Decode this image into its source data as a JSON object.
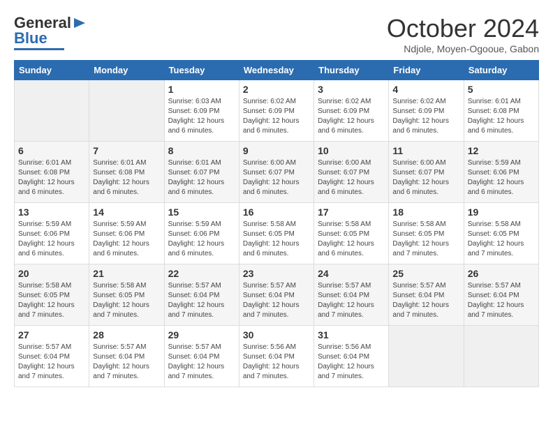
{
  "header": {
    "logo_general": "General",
    "logo_blue": "Blue",
    "month": "October 2024",
    "location": "Ndjole, Moyen-Ogooue, Gabon"
  },
  "weekdays": [
    "Sunday",
    "Monday",
    "Tuesday",
    "Wednesday",
    "Thursday",
    "Friday",
    "Saturday"
  ],
  "weeks": [
    [
      {
        "day": "",
        "content": ""
      },
      {
        "day": "",
        "content": ""
      },
      {
        "day": "1",
        "content": "Sunrise: 6:03 AM\nSunset: 6:09 PM\nDaylight: 12 hours\nand 6 minutes."
      },
      {
        "day": "2",
        "content": "Sunrise: 6:02 AM\nSunset: 6:09 PM\nDaylight: 12 hours\nand 6 minutes."
      },
      {
        "day": "3",
        "content": "Sunrise: 6:02 AM\nSunset: 6:09 PM\nDaylight: 12 hours\nand 6 minutes."
      },
      {
        "day": "4",
        "content": "Sunrise: 6:02 AM\nSunset: 6:09 PM\nDaylight: 12 hours\nand 6 minutes."
      },
      {
        "day": "5",
        "content": "Sunrise: 6:01 AM\nSunset: 6:08 PM\nDaylight: 12 hours\nand 6 minutes."
      }
    ],
    [
      {
        "day": "6",
        "content": "Sunrise: 6:01 AM\nSunset: 6:08 PM\nDaylight: 12 hours\nand 6 minutes."
      },
      {
        "day": "7",
        "content": "Sunrise: 6:01 AM\nSunset: 6:08 PM\nDaylight: 12 hours\nand 6 minutes."
      },
      {
        "day": "8",
        "content": "Sunrise: 6:01 AM\nSunset: 6:07 PM\nDaylight: 12 hours\nand 6 minutes."
      },
      {
        "day": "9",
        "content": "Sunrise: 6:00 AM\nSunset: 6:07 PM\nDaylight: 12 hours\nand 6 minutes."
      },
      {
        "day": "10",
        "content": "Sunrise: 6:00 AM\nSunset: 6:07 PM\nDaylight: 12 hours\nand 6 minutes."
      },
      {
        "day": "11",
        "content": "Sunrise: 6:00 AM\nSunset: 6:07 PM\nDaylight: 12 hours\nand 6 minutes."
      },
      {
        "day": "12",
        "content": "Sunrise: 5:59 AM\nSunset: 6:06 PM\nDaylight: 12 hours\nand 6 minutes."
      }
    ],
    [
      {
        "day": "13",
        "content": "Sunrise: 5:59 AM\nSunset: 6:06 PM\nDaylight: 12 hours\nand 6 minutes."
      },
      {
        "day": "14",
        "content": "Sunrise: 5:59 AM\nSunset: 6:06 PM\nDaylight: 12 hours\nand 6 minutes."
      },
      {
        "day": "15",
        "content": "Sunrise: 5:59 AM\nSunset: 6:06 PM\nDaylight: 12 hours\nand 6 minutes."
      },
      {
        "day": "16",
        "content": "Sunrise: 5:58 AM\nSunset: 6:05 PM\nDaylight: 12 hours\nand 6 minutes."
      },
      {
        "day": "17",
        "content": "Sunrise: 5:58 AM\nSunset: 6:05 PM\nDaylight: 12 hours\nand 6 minutes."
      },
      {
        "day": "18",
        "content": "Sunrise: 5:58 AM\nSunset: 6:05 PM\nDaylight: 12 hours\nand 7 minutes."
      },
      {
        "day": "19",
        "content": "Sunrise: 5:58 AM\nSunset: 6:05 PM\nDaylight: 12 hours\nand 7 minutes."
      }
    ],
    [
      {
        "day": "20",
        "content": "Sunrise: 5:58 AM\nSunset: 6:05 PM\nDaylight: 12 hours\nand 7 minutes."
      },
      {
        "day": "21",
        "content": "Sunrise: 5:58 AM\nSunset: 6:05 PM\nDaylight: 12 hours\nand 7 minutes."
      },
      {
        "day": "22",
        "content": "Sunrise: 5:57 AM\nSunset: 6:04 PM\nDaylight: 12 hours\nand 7 minutes."
      },
      {
        "day": "23",
        "content": "Sunrise: 5:57 AM\nSunset: 6:04 PM\nDaylight: 12 hours\nand 7 minutes."
      },
      {
        "day": "24",
        "content": "Sunrise: 5:57 AM\nSunset: 6:04 PM\nDaylight: 12 hours\nand 7 minutes."
      },
      {
        "day": "25",
        "content": "Sunrise: 5:57 AM\nSunset: 6:04 PM\nDaylight: 12 hours\nand 7 minutes."
      },
      {
        "day": "26",
        "content": "Sunrise: 5:57 AM\nSunset: 6:04 PM\nDaylight: 12 hours\nand 7 minutes."
      }
    ],
    [
      {
        "day": "27",
        "content": "Sunrise: 5:57 AM\nSunset: 6:04 PM\nDaylight: 12 hours\nand 7 minutes."
      },
      {
        "day": "28",
        "content": "Sunrise: 5:57 AM\nSunset: 6:04 PM\nDaylight: 12 hours\nand 7 minutes."
      },
      {
        "day": "29",
        "content": "Sunrise: 5:57 AM\nSunset: 6:04 PM\nDaylight: 12 hours\nand 7 minutes."
      },
      {
        "day": "30",
        "content": "Sunrise: 5:56 AM\nSunset: 6:04 PM\nDaylight: 12 hours\nand 7 minutes."
      },
      {
        "day": "31",
        "content": "Sunrise: 5:56 AM\nSunset: 6:04 PM\nDaylight: 12 hours\nand 7 minutes."
      },
      {
        "day": "",
        "content": ""
      },
      {
        "day": "",
        "content": ""
      }
    ]
  ]
}
